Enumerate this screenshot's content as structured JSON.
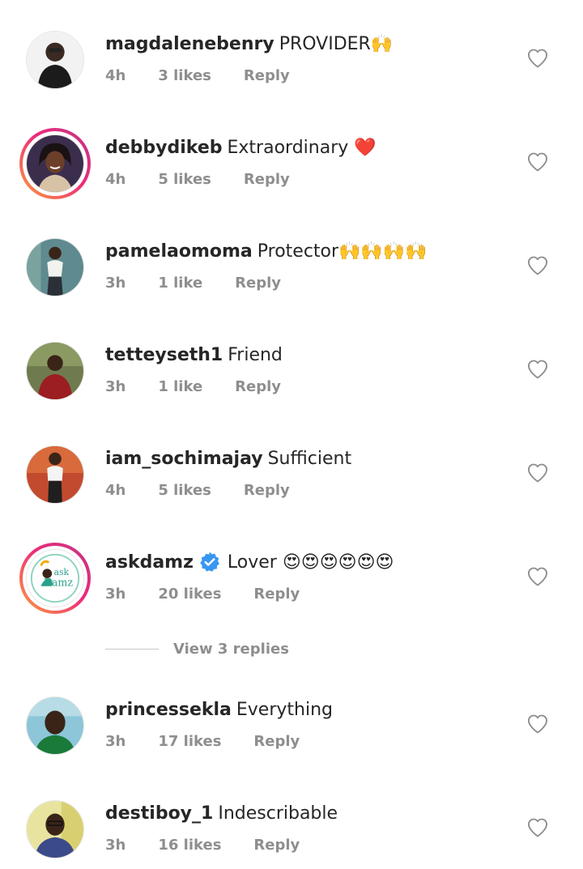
{
  "comments": [
    {
      "username": "magdalenebenry",
      "text": "PROVIDER🙌",
      "time": "4h",
      "likes": "3 likes",
      "reply": "Reply",
      "story_ring": false,
      "verified": false
    },
    {
      "username": "debbydikeb",
      "text": "Extraordinary ❤️",
      "time": "4h",
      "likes": "5 likes",
      "reply": "Reply",
      "story_ring": true,
      "verified": false
    },
    {
      "username": "pamelaomoma",
      "text": "Protector🙌🙌🙌🙌",
      "time": "3h",
      "likes": "1 like",
      "reply": "Reply",
      "story_ring": false,
      "verified": false
    },
    {
      "username": "tetteyseth1",
      "text": "Friend",
      "time": "3h",
      "likes": "1 like",
      "reply": "Reply",
      "story_ring": false,
      "verified": false
    },
    {
      "username": "iam_sochimajay",
      "text": "Sufficient",
      "time": "4h",
      "likes": "5 likes",
      "reply": "Reply",
      "story_ring": false,
      "verified": false
    },
    {
      "username": "askdamz",
      "text": "Lover 😍😍😍😍😍😍",
      "time": "3h",
      "likes": "20 likes",
      "reply": "Reply",
      "story_ring": true,
      "verified": true,
      "avatar_text": [
        "ask",
        "Damz"
      ]
    },
    {
      "username": "princessekla",
      "text": "Everything",
      "time": "3h",
      "likes": "17 likes",
      "reply": "Reply",
      "story_ring": false,
      "verified": false
    },
    {
      "username": "destiboy_1",
      "text": "Indescribable",
      "time": "3h",
      "likes": "16 likes",
      "reply": "Reply",
      "story_ring": false,
      "verified": false
    }
  ],
  "view_replies": "View 3 replies",
  "colors": {
    "text": "#262626",
    "meta": "#8e8e8e",
    "verified": "#3897f0",
    "heart_outline": "#8e8e8e"
  },
  "icons": {
    "like": "heart-outline-icon",
    "verified": "verified-badge-icon"
  }
}
